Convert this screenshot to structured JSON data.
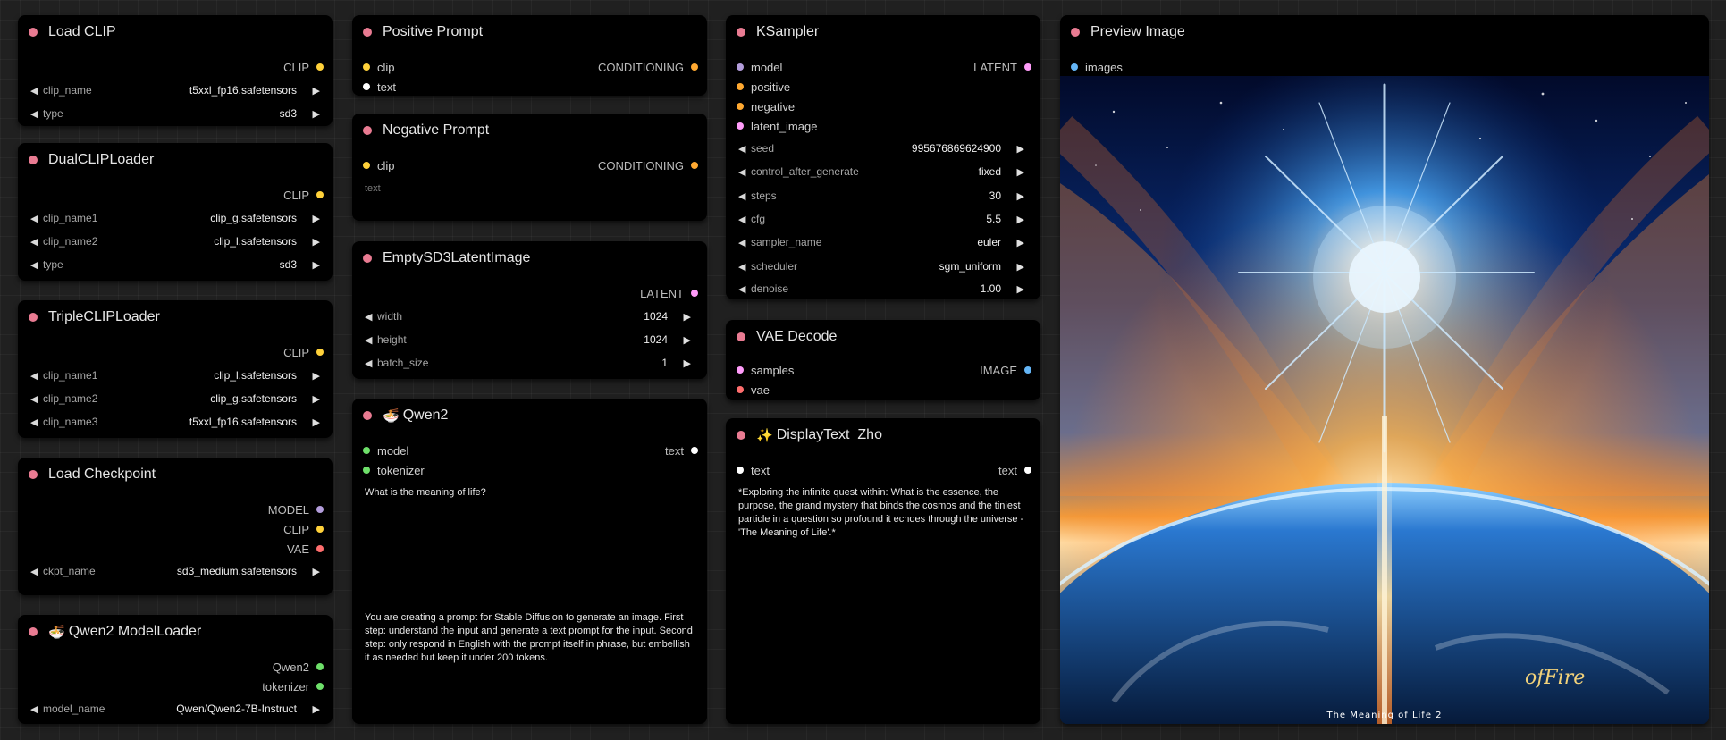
{
  "nodes": {
    "load_clip": {
      "title": "Load CLIP",
      "outputs": [
        "CLIP"
      ],
      "widgets": [
        {
          "label": "clip_name",
          "value": "t5xxl_fp16.safetensors"
        },
        {
          "label": "type",
          "value": "sd3"
        }
      ]
    },
    "dual_clip_loader": {
      "title": "DualCLIPLoader",
      "outputs": [
        "CLIP"
      ],
      "widgets": [
        {
          "label": "clip_name1",
          "value": "clip_g.safetensors"
        },
        {
          "label": "clip_name2",
          "value": "clip_l.safetensors"
        },
        {
          "label": "type",
          "value": "sd3"
        }
      ]
    },
    "triple_clip_loader": {
      "title": "TripleCLIPLoader",
      "outputs": [
        "CLIP"
      ],
      "widgets": [
        {
          "label": "clip_name1",
          "value": "clip_l.safetensors"
        },
        {
          "label": "clip_name2",
          "value": "clip_g.safetensors"
        },
        {
          "label": "clip_name3",
          "value": "t5xxl_fp16.safetensors"
        }
      ]
    },
    "load_checkpoint": {
      "title": "Load Checkpoint",
      "outputs": [
        "MODEL",
        "CLIP",
        "VAE"
      ],
      "widgets": [
        {
          "label": "ckpt_name",
          "value": "sd3_medium.safetensors"
        }
      ]
    },
    "qwen2_model_loader": {
      "title": "Qwen2 ModelLoader",
      "emoji": "🍜",
      "outputs": [
        "Qwen2",
        "tokenizer"
      ],
      "widgets": [
        {
          "label": "model_name",
          "value": "Qwen/Qwen2-7B-Instruct"
        }
      ]
    },
    "positive_prompt": {
      "title": "Positive Prompt",
      "inputs": [
        "clip",
        "text"
      ],
      "outputs": [
        "CONDITIONING"
      ]
    },
    "negative_prompt": {
      "title": "Negative Prompt",
      "inputs": [
        "clip"
      ],
      "outputs": [
        "CONDITIONING"
      ],
      "placeholder": "text"
    },
    "empty_latent": {
      "title": "EmptySD3LatentImage",
      "outputs": [
        "LATENT"
      ],
      "widgets": [
        {
          "label": "width",
          "value": "1024"
        },
        {
          "label": "height",
          "value": "1024"
        },
        {
          "label": "batch_size",
          "value": "1"
        }
      ]
    },
    "qwen2": {
      "title": "Qwen2",
      "emoji": "🍜",
      "inputs": [
        "model",
        "tokenizer"
      ],
      "outputs": [
        "text"
      ],
      "prompt": "What is the meaning of life?",
      "system": "You are creating a prompt for Stable Diffusion to generate an image. First step: understand the input and generate a text prompt for the input. Second step: only respond in English with the prompt itself in phrase, but embellish it as needed but keep it under 200 tokens."
    },
    "ksampler": {
      "title": "KSampler",
      "inputs": [
        "model",
        "positive",
        "negative",
        "latent_image"
      ],
      "outputs": [
        "LATENT"
      ],
      "widgets": [
        {
          "label": "seed",
          "value": "995676869624900"
        },
        {
          "label": "control_after_generate",
          "value": "fixed"
        },
        {
          "label": "steps",
          "value": "30"
        },
        {
          "label": "cfg",
          "value": "5.5"
        },
        {
          "label": "sampler_name",
          "value": "euler"
        },
        {
          "label": "scheduler",
          "value": "sgm_uniform"
        },
        {
          "label": "denoise",
          "value": "1.00"
        }
      ]
    },
    "vae_decode": {
      "title": "VAE Decode",
      "inputs": [
        "samples",
        "vae"
      ],
      "outputs": [
        "IMAGE"
      ]
    },
    "display_text": {
      "title": "DisplayText_Zho",
      "emoji": "✨",
      "inputs": [
        "text"
      ],
      "outputs": [
        "text"
      ],
      "content": "*Exploring the infinite quest within: What is the essence, the purpose, the grand mystery that binds the cosmos and the tiniest particle in a question so profound it echoes through the universe - 'The Meaning of Life'.*"
    },
    "preview_image": {
      "title": "Preview Image",
      "inputs": [
        "images"
      ],
      "image_caption": "The Meaning of Life 2",
      "image_signature": "ofFire"
    }
  },
  "colors": {
    "title_dot": "#e97b92",
    "clip": "#ffd13a",
    "conditioning": "#ffa931",
    "latent": "#ff9cf9",
    "model": "#b39ddb",
    "vae": "#ff6e6e",
    "image": "#64b5f6",
    "qwen": "#6ee06a"
  }
}
